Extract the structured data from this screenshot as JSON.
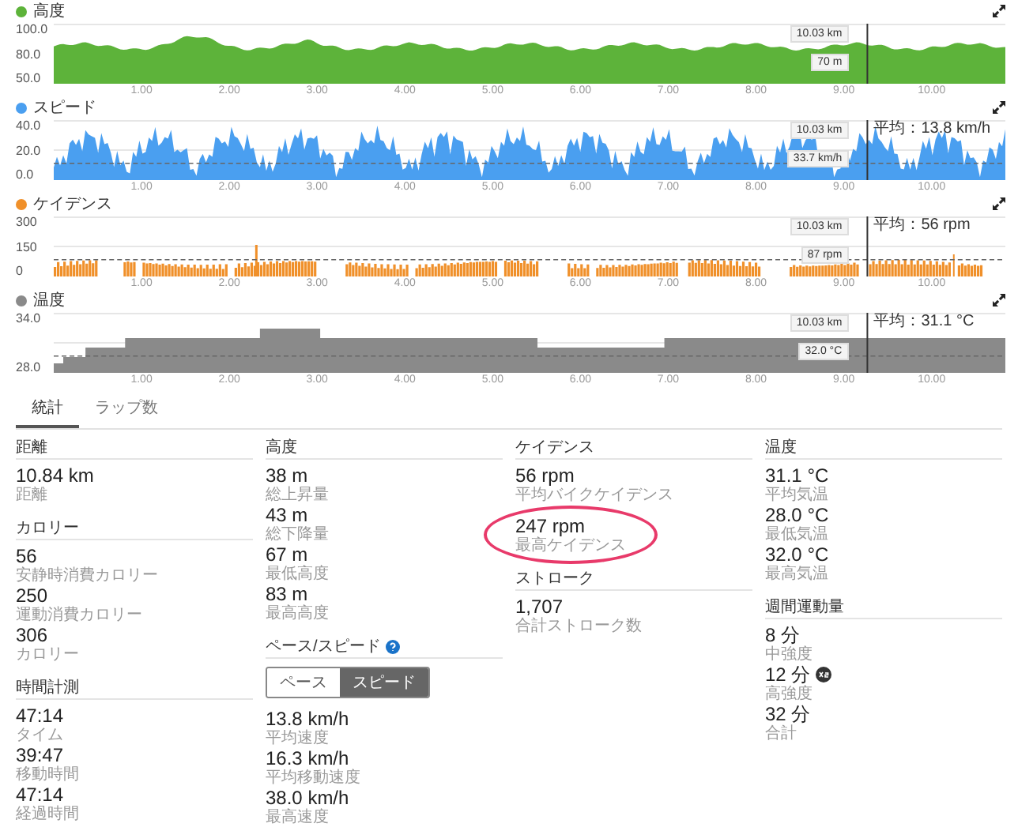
{
  "charts": [
    {
      "title": "高度",
      "kind": "area",
      "color": "#5db33a",
      "yticks": [
        "100.0",
        "80.0",
        "50.0"
      ],
      "xticks": [
        "1.00",
        "2.00",
        "3.00",
        "4.00",
        "5.00",
        "6.00",
        "7.00",
        "8.00",
        "9.00",
        "10.00"
      ],
      "cursor": {
        "distance": "10.03 km",
        "value": "70 m"
      }
    },
    {
      "title": "スピード",
      "kind": "area",
      "color": "#4a9ff0",
      "yticks": [
        "40.0",
        "20.0",
        "0.0"
      ],
      "xticks": [
        "1.00",
        "2.00",
        "3.00",
        "4.00",
        "5.00",
        "6.00",
        "7.00",
        "8.00",
        "9.00",
        "10.00"
      ],
      "average": "平均：13.8 km/h",
      "cursor": {
        "distance": "10.03 km",
        "value": "33.7 km/h"
      }
    },
    {
      "title": "ケイデンス",
      "kind": "bars",
      "color": "#f0902a",
      "yticks": [
        "300",
        "150",
        "0"
      ],
      "xticks": [
        "1.00",
        "2.00",
        "3.00",
        "4.00",
        "5.00",
        "6.00",
        "7.00",
        "8.00",
        "9.00",
        "10.00"
      ],
      "average": "平均：56 rpm",
      "cursor": {
        "distance": "10.03 km",
        "value": "87 rpm"
      }
    },
    {
      "title": "温度",
      "kind": "step",
      "color": "#8a8a8a",
      "yticks": [
        "34.0",
        "28.0"
      ],
      "xticks": [
        "1.00",
        "2.00",
        "3.00",
        "4.00",
        "5.00",
        "6.00",
        "7.00",
        "8.00",
        "9.00",
        "10.00"
      ],
      "average": "平均：31.1 °C",
      "cursor": {
        "distance": "10.03 km",
        "value": "32.0 °C"
      }
    }
  ],
  "tabs": [
    {
      "label": "統計",
      "selected": true
    },
    {
      "label": "ラップ数",
      "selected": false
    }
  ],
  "columns": [
    [
      {
        "title": "距離",
        "help": false,
        "items": [
          {
            "value": "10.84 km",
            "label": "距離"
          }
        ]
      },
      {
        "title": "カロリー",
        "help": false,
        "items": [
          {
            "value": "56",
            "label": "安静時消費カロリー"
          },
          {
            "value": "250",
            "label": "運動消費カロリー"
          },
          {
            "value": "306",
            "label": "カロリー"
          }
        ]
      },
      {
        "title": "時間計測",
        "help": false,
        "items": [
          {
            "value": "47:14",
            "label": "タイム"
          },
          {
            "value": "39:47",
            "label": "移動時間"
          },
          {
            "value": "47:14",
            "label": "経過時間"
          }
        ]
      }
    ],
    [
      {
        "title": "高度",
        "help": false,
        "items": [
          {
            "value": "38 m",
            "label": "総上昇量"
          },
          {
            "value": "43 m",
            "label": "総下降量"
          },
          {
            "value": "67 m",
            "label": "最低高度"
          },
          {
            "value": "83 m",
            "label": "最高高度"
          }
        ]
      },
      {
        "title": "ペース/スピード",
        "help": true,
        "toggle": [
          {
            "label": "ペース",
            "selected": false
          },
          {
            "label": "スピード",
            "selected": true
          }
        ],
        "items": [
          {
            "value": "13.8 km/h",
            "label": "平均速度"
          },
          {
            "value": "16.3 km/h",
            "label": "平均移動速度"
          },
          {
            "value": "38.0 km/h",
            "label": "最高速度"
          }
        ]
      }
    ],
    [
      {
        "title": "ケイデンス",
        "help": false,
        "items": [
          {
            "value": "56 rpm",
            "label": "平均バイクケイデンス",
            "highlighted": false
          },
          {
            "value": "247 rpm",
            "label": "最高ケイデンス",
            "highlighted": true
          }
        ]
      },
      {
        "title": "ストローク",
        "help": false,
        "items": [
          {
            "value": "1,707",
            "label": "合計ストローク数"
          }
        ]
      }
    ],
    [
      {
        "title": "温度",
        "help": false,
        "items": [
          {
            "value": "31.1 °C",
            "label": "平均気温"
          },
          {
            "value": "28.0 °C",
            "label": "最低気温"
          },
          {
            "value": "32.0 °C",
            "label": "最高気温"
          }
        ]
      },
      {
        "title": "週間運動量",
        "help": false,
        "items": [
          {
            "value": "8 分",
            "label": "中強度",
            "badge": false
          },
          {
            "value": "12 分",
            "label": "高強度",
            "badge": true
          },
          {
            "value": "32 分",
            "label": "合計",
            "badge": false
          }
        ]
      }
    ]
  ]
}
